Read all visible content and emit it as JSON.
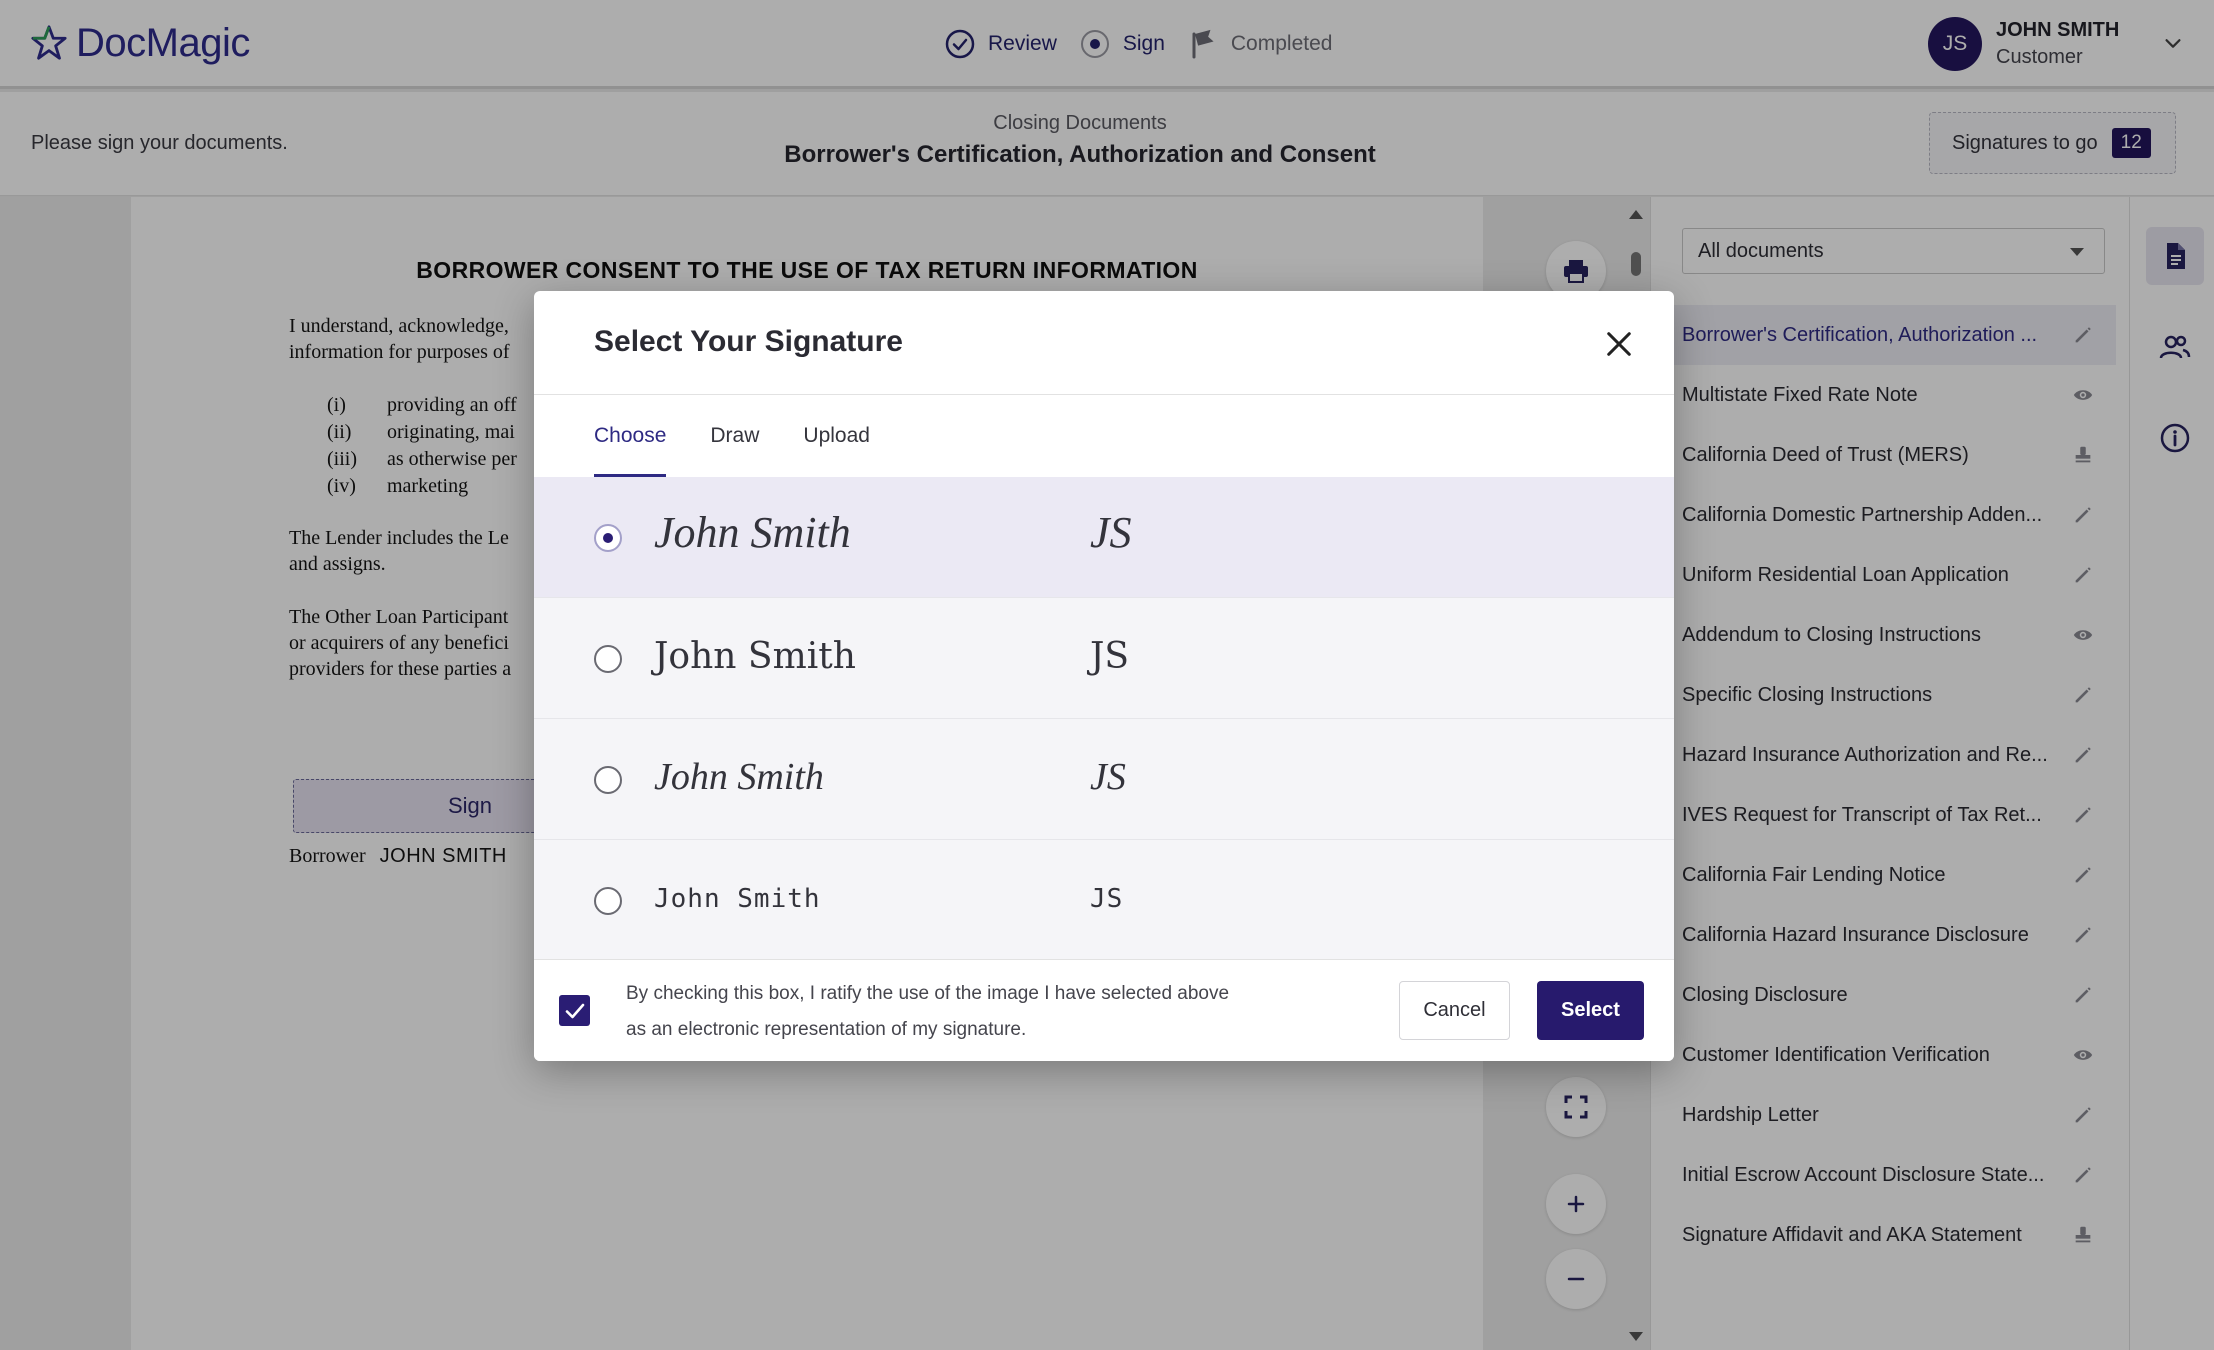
{
  "app": {
    "brand": "DocMagic",
    "accent": "#271a6d",
    "brand_color": "#2e2b8c"
  },
  "steps": [
    {
      "label": "Review",
      "state": "done",
      "icon": "check-circle-icon"
    },
    {
      "label": "Sign",
      "state": "current",
      "icon": "radio-dot-icon"
    },
    {
      "label": "Completed",
      "state": "pending",
      "icon": "flag-icon"
    }
  ],
  "user": {
    "initials": "JS",
    "name": "JOHN SMITH",
    "role": "Customer"
  },
  "subheader": {
    "instruction": "Please sign your documents.",
    "doc_group": "Closing Documents",
    "doc_title": "Borrower's Certification, Authorization and Consent",
    "signatures_label": "Signatures to go",
    "signatures_count": "12"
  },
  "document": {
    "heading": "BORROWER CONSENT TO THE USE OF TAX RETURN INFORMATION",
    "paragraph1": "I understand, acknowledge,",
    "paragraph1_line2": "information for purposes of",
    "list": [
      {
        "num": "(i)",
        "text": "providing an off"
      },
      {
        "num": "(ii)",
        "text": "originating, mai"
      },
      {
        "num": "(iii)",
        "text": "as otherwise per"
      },
      {
        "num": "(iv)",
        "text": "marketing"
      }
    ],
    "paragraph2": "The Lender includes the Le",
    "paragraph2_line2": "and assigns.",
    "paragraph3": "The Other Loan Participant",
    "paragraph3_line2": "or acquirers of any benefici",
    "paragraph3_line3": "providers for these parties a",
    "sign_label": "Sign",
    "borrower_label": "Borrower",
    "borrower_name": "JOHN SMITH"
  },
  "panel": {
    "filter": "All documents",
    "documents": [
      {
        "label": "Borrower's Certification, Authorization ...",
        "icon": "pencil-icon",
        "active": true
      },
      {
        "label": "Multistate Fixed Rate Note",
        "icon": "eye-icon"
      },
      {
        "label": "California Deed of Trust (MERS)",
        "icon": "stamp-icon"
      },
      {
        "label": "California Domestic Partnership Adden...",
        "icon": "pencil-icon"
      },
      {
        "label": "Uniform Residential Loan Application",
        "icon": "pencil-icon"
      },
      {
        "label": "Addendum to Closing Instructions",
        "icon": "eye-icon"
      },
      {
        "label": "Specific Closing Instructions",
        "icon": "pencil-icon"
      },
      {
        "label": "Hazard Insurance Authorization and Re...",
        "icon": "pencil-icon"
      },
      {
        "label": "IVES Request for Transcript of Tax Ret...",
        "icon": "pencil-icon"
      },
      {
        "label": "California Fair Lending Notice",
        "icon": "pencil-icon"
      },
      {
        "label": "California Hazard Insurance Disclosure",
        "icon": "pencil-icon"
      },
      {
        "label": "Closing Disclosure",
        "icon": "pencil-icon"
      },
      {
        "label": "Customer Identification Verification",
        "icon": "eye-icon"
      },
      {
        "label": "Hardship Letter",
        "icon": "pencil-icon"
      },
      {
        "label": "Initial Escrow Account Disclosure State...",
        "icon": "pencil-icon"
      },
      {
        "label": "Signature Affidavit and AKA Statement",
        "icon": "stamp-icon"
      }
    ]
  },
  "modal": {
    "title": "Select Your Signature",
    "tabs": [
      {
        "label": "Choose",
        "active": true
      },
      {
        "label": "Draw"
      },
      {
        "label": "Upload"
      }
    ],
    "options": [
      {
        "name": "John Smith",
        "initials": "JS",
        "selected": true
      },
      {
        "name": "John Smith",
        "initials": "JS"
      },
      {
        "name": "John Smith",
        "initials": "JS"
      },
      {
        "name": "John Smith",
        "initials": "JS"
      }
    ],
    "ratify_text": "By checking this box, I ratify the use of the image I have selected above as an electronic representation of my signature.",
    "ratify_checked": true,
    "cancel_label": "Cancel",
    "select_label": "Select"
  }
}
